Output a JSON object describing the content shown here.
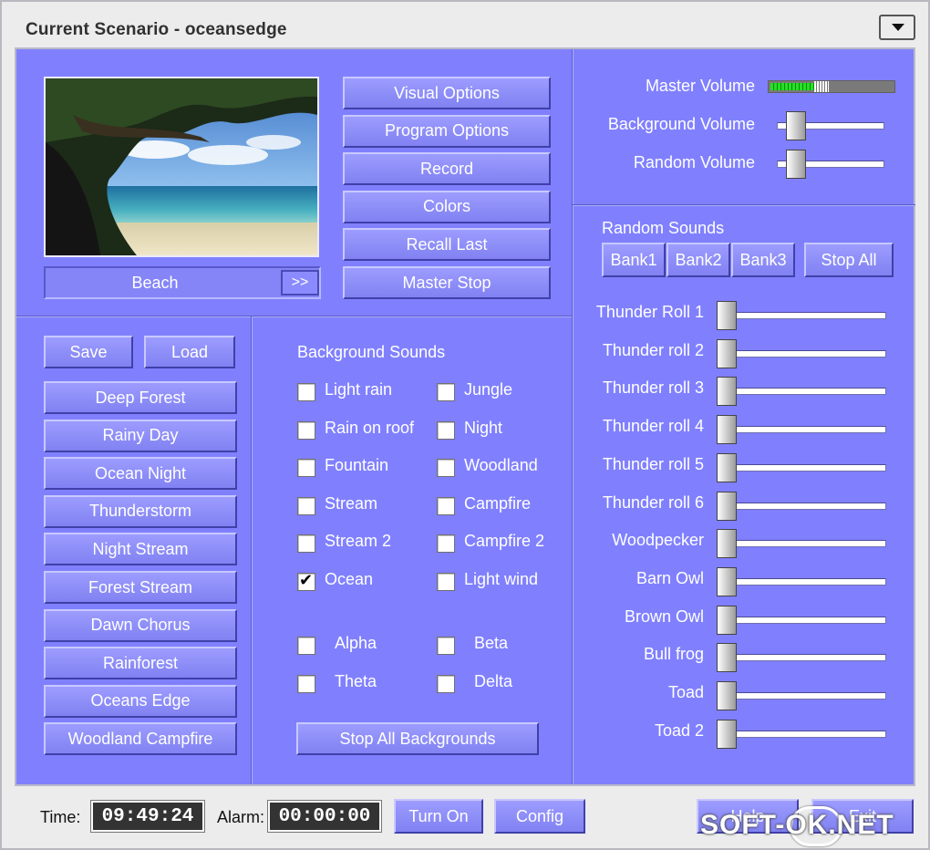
{
  "window": {
    "title": "Current Scenario - oceansedge"
  },
  "scenario": {
    "name": "Beach",
    "next_label": ">>"
  },
  "actions": [
    "Visual Options",
    "Program Options",
    "Record",
    "Colors",
    "Recall Last",
    "Master Stop"
  ],
  "presets": {
    "save_label": "Save",
    "load_label": "Load",
    "items": [
      "Deep Forest",
      "Rainy Day",
      "Ocean Night",
      "Thunderstorm",
      "Night Stream",
      "Forest Stream",
      "Dawn Chorus",
      "Rainforest",
      "Oceans Edge",
      "Woodland Campfire"
    ]
  },
  "background": {
    "heading": "Background Sounds",
    "left": [
      {
        "label": "Light rain",
        "checked": false
      },
      {
        "label": "Rain on roof",
        "checked": false
      },
      {
        "label": "Fountain",
        "checked": false
      },
      {
        "label": "Stream",
        "checked": false
      },
      {
        "label": "Stream 2",
        "checked": false
      },
      {
        "label": "Ocean",
        "checked": true
      }
    ],
    "right": [
      {
        "label": "Jungle",
        "checked": false
      },
      {
        "label": "Night",
        "checked": false
      },
      {
        "label": "Woodland",
        "checked": false
      },
      {
        "label": "Campfire",
        "checked": false
      },
      {
        "label": "Campfire 2",
        "checked": false
      },
      {
        "label": "Light wind",
        "checked": false
      }
    ],
    "waves": [
      {
        "label": "Alpha",
        "checked": false
      },
      {
        "label": "Beta",
        "checked": false
      },
      {
        "label": "Theta",
        "checked": false
      },
      {
        "label": "Delta",
        "checked": false
      }
    ],
    "stop_all_label": "Stop All Backgrounds"
  },
  "volume": {
    "master_label": "Master Volume",
    "master_level": 0.35,
    "background_label": "Background Volume",
    "background_level": 0.1,
    "random_label": "Random Volume",
    "random_level": 0.1
  },
  "random": {
    "heading": "Random Sounds",
    "banks": [
      "Bank1",
      "Bank2",
      "Bank3"
    ],
    "stop_all_label": "Stop All",
    "sounds": [
      {
        "label": "Thunder Roll 1",
        "level": 0
      },
      {
        "label": "Thunder roll 2",
        "level": 0
      },
      {
        "label": "Thunder roll 3",
        "level": 0
      },
      {
        "label": "Thunder roll 4",
        "level": 0
      },
      {
        "label": "Thunder roll 5",
        "level": 0
      },
      {
        "label": "Thunder roll 6",
        "level": 0
      },
      {
        "label": "Woodpecker",
        "level": 0
      },
      {
        "label": "Barn Owl",
        "level": 0
      },
      {
        "label": "Brown Owl",
        "level": 0
      },
      {
        "label": "Bull frog",
        "level": 0
      },
      {
        "label": "Toad",
        "level": 0
      },
      {
        "label": "Toad 2",
        "level": 0
      }
    ]
  },
  "status": {
    "time_label": "Time:",
    "time_value": "09:49:24",
    "alarm_label": "Alarm:",
    "alarm_value": "00:00:00",
    "turn_on_label": "Turn On",
    "config_label": "Config",
    "help_label": "Help",
    "exit_label": "Exit"
  },
  "watermark": "SOFT-OK.NET",
  "icons": {
    "menu": "dropdown-arrow-icon",
    "checkbox": "check-mark-icon"
  }
}
